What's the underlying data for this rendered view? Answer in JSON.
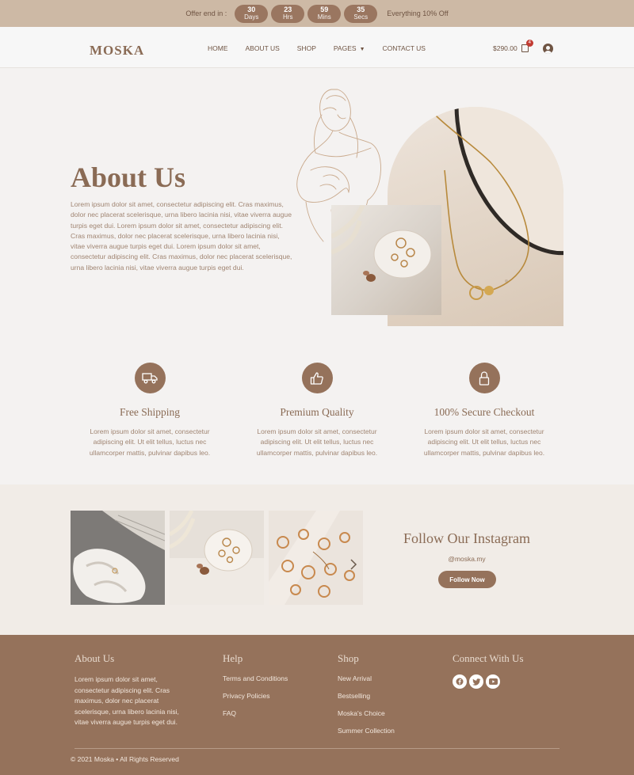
{
  "topbar": {
    "offer_label": "Offer end in :",
    "countdown": [
      {
        "value": "30",
        "unit": "Days"
      },
      {
        "value": "23",
        "unit": "Hrs"
      },
      {
        "value": "59",
        "unit": "Mins"
      },
      {
        "value": "35",
        "unit": "Secs"
      }
    ],
    "promo": "Everything 10% Off"
  },
  "header": {
    "logo": "MOSKA",
    "nav": [
      "HOME",
      "ABOUT US",
      "SHOP",
      "PAGES",
      "CONTACT US"
    ],
    "cart_total": "$290.00",
    "cart_count": "4"
  },
  "about": {
    "title": "About Us",
    "text": "Lorem ipsum dolor sit amet, consectetur adipiscing elit. Cras maximus, dolor nec placerat scelerisque, urna libero lacinia nisi, vitae viverra augue turpis eget dui. Lorem ipsum dolor sit amet, consectetur adipiscing elit. Cras maximus, dolor nec placerat scelerisque, urna libero lacinia nisi, vitae viverra augue turpis eget dui. Lorem ipsum dolor sit amet, consectetur adipiscing elit. Cras maximus, dolor nec placerat scelerisque, urna libero lacinia nisi, vitae viverra augue turpis eget dui."
  },
  "features": [
    {
      "icon": "truck-icon",
      "title": "Free Shipping",
      "text": "Lorem ipsum dolor sit amet, consectetur adipiscing elit. Ut elit tellus, luctus nec ullamcorper mattis, pulvinar dapibus leo."
    },
    {
      "icon": "thumbs-up-icon",
      "title": "Premium Quality",
      "text": "Lorem ipsum dolor sit amet, consectetur adipiscing elit. Ut elit tellus, luctus nec ullamcorper mattis, pulvinar dapibus leo."
    },
    {
      "icon": "lock-icon",
      "title": "100% Secure Checkout",
      "text": "Lorem ipsum dolor sit amet, consectetur adipiscing elit. Ut elit tellus, luctus nec ullamcorper mattis, pulvinar dapibus leo."
    }
  ],
  "instagram": {
    "title": "Follow Our Instagram",
    "handle": "@moska.my",
    "button": "Follow Now"
  },
  "footer": {
    "about_title": "About Us",
    "about_text": "Lorem ipsum dolor sit amet, consectetur adipiscing elit. Cras maximus, dolor nec placerat scelerisque, urna libero lacinia nisi, vitae viverra augue turpis eget dui.",
    "help_title": "Help",
    "help_links": [
      "Terms and Conditions",
      "Privacy Policies",
      "FAQ"
    ],
    "shop_title": "Shop",
    "shop_links": [
      "New Arrival",
      "Bestselling",
      "Moska's Choice",
      "Summer Collection"
    ],
    "connect_title": "Connect With Us",
    "socials": [
      "facebook-icon",
      "twitter-icon",
      "youtube-icon"
    ],
    "copyright": "© 2021 Moska • All Rights Reserved"
  },
  "colors": {
    "accent": "#95725b",
    "topbar": "#cdb9a5",
    "text": "#8a6b55"
  }
}
